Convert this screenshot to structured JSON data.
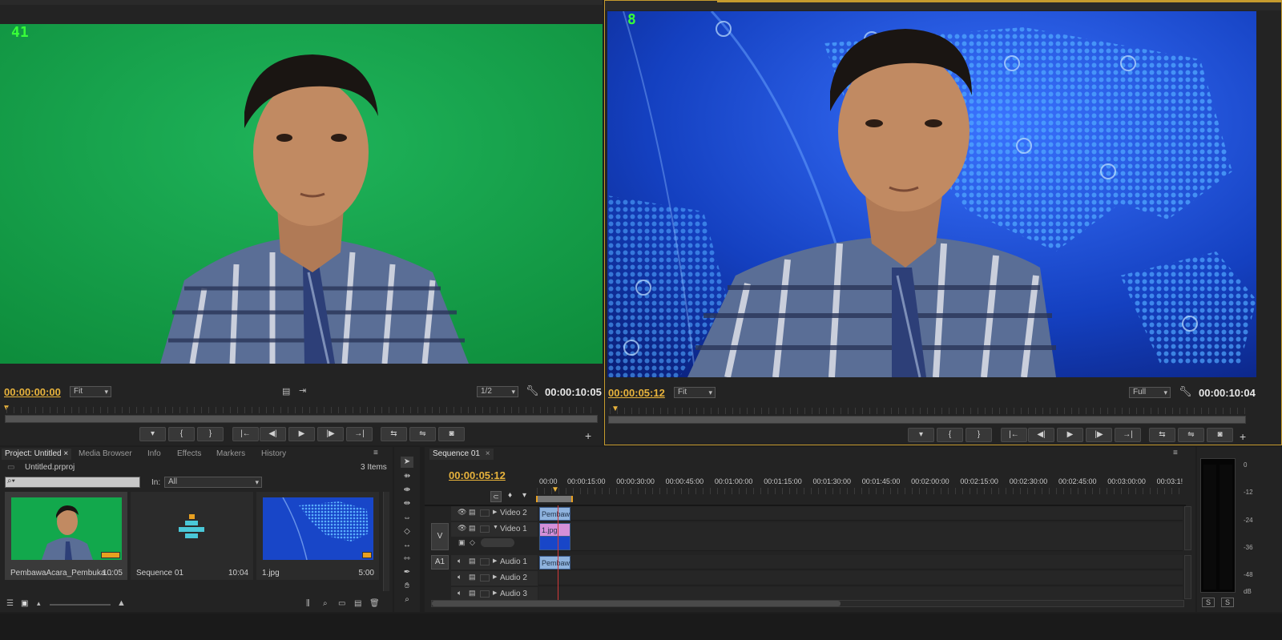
{
  "source_monitor": {
    "frame_counter": "41",
    "timecode_in": "00:00:00:00",
    "zoom": "Fit",
    "resolution": "1/2",
    "duration": "00:00:10:05"
  },
  "program_monitor": {
    "frame_counter": "8",
    "timecode_in": "00:00:05:12",
    "zoom": "Fit",
    "resolution": "Full",
    "duration": "00:00:10:04"
  },
  "transport_buttons": [
    "▾",
    "{",
    "}",
    "|←",
    "◀|",
    "▶",
    "|▶",
    "→|",
    "⇆",
    "⇋",
    "◙"
  ],
  "project_panel": {
    "tabs": [
      "Project: Untitled",
      "Media Browser",
      "Info",
      "Effects",
      "Markers",
      "History"
    ],
    "project_file": "Untitled.prproj",
    "item_count": "3 Items",
    "in_label": "In:",
    "in_value": "All",
    "items": [
      {
        "name": "PembawaAcara_Pembuka...",
        "duration": "10:05"
      },
      {
        "name": "Sequence 01",
        "duration": "10:04"
      },
      {
        "name": "1.jpg",
        "duration": "5:00"
      }
    ]
  },
  "timeline": {
    "tab": "Sequence 01",
    "timecode": "00:00:05:12",
    "ruler": [
      "00:00",
      "00:00:15:00",
      "00:00:30:00",
      "00:00:45:00",
      "00:01:00:00",
      "00:01:15:00",
      "00:01:30:00",
      "00:01:45:00",
      "00:02:00:00",
      "00:02:15:00",
      "00:02:30:00",
      "00:02:45:00",
      "00:03:00:00",
      "00:03:1!"
    ],
    "source_v": "V",
    "source_a": "A1",
    "tracks": [
      {
        "name": "Video 2",
        "clip": "Pembawa"
      },
      {
        "name": "Video 1",
        "clip": "1.jpg"
      },
      {
        "name": "Audio 1",
        "clip": "Pembawa"
      },
      {
        "name": "Audio 2",
        "clip": ""
      },
      {
        "name": "Audio 3",
        "clip": ""
      }
    ],
    "playhead_fraction": 0.03
  },
  "audio_meter": {
    "labels": [
      "0",
      "-12",
      "-24",
      "-36",
      "-48",
      "dB"
    ],
    "solo_labels": [
      "S",
      "S"
    ]
  },
  "colors": {
    "accent": "#e8b33c",
    "green_screen": "#12a84c",
    "news_blue": "#1846c8",
    "clip_video": "#8fb3de",
    "clip_image": "#d48fd8"
  }
}
